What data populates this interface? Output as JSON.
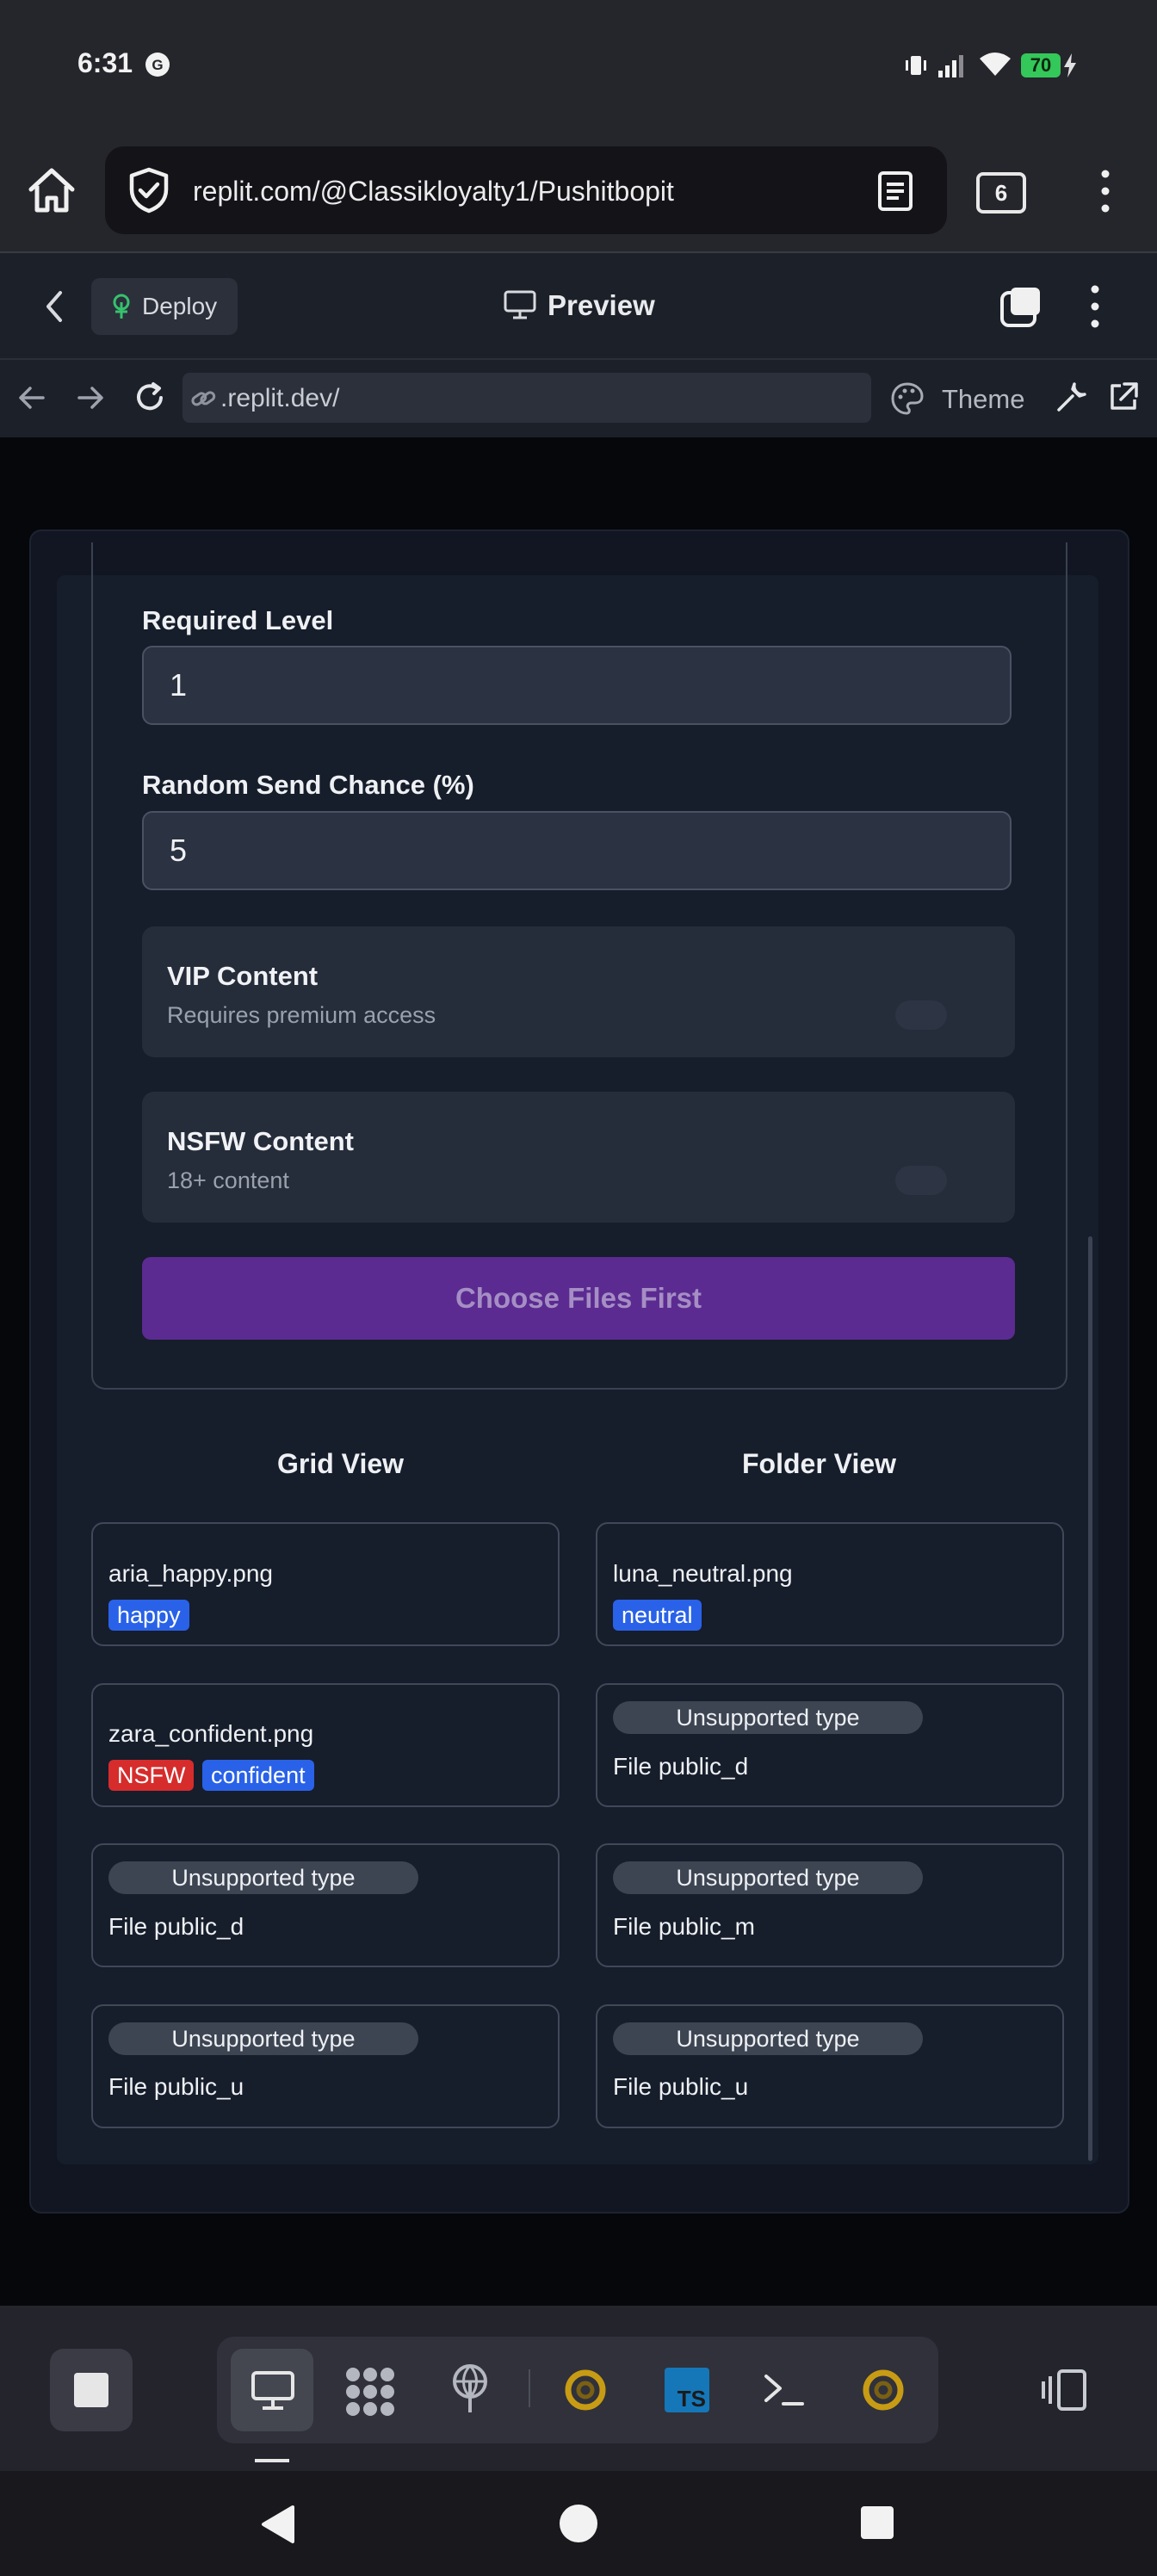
{
  "status_bar": {
    "time": "6:31",
    "battery": "70"
  },
  "browser": {
    "url": "replit.com/@Classikloyalty1/Pushitbopit",
    "tab_count": "6"
  },
  "replit": {
    "deploy_label": "Deploy",
    "preview_label": "Preview",
    "url": ".replit.dev/",
    "theme_label": "Theme"
  },
  "form": {
    "required_level_label": "Required Level",
    "required_level_value": "1",
    "random_send_label": "Random Send Chance (%)",
    "random_send_value": "5",
    "vip_title": "VIP Content",
    "vip_desc": "Requires premium access",
    "nsfw_title": "NSFW Content",
    "nsfw_desc": "18+ content",
    "submit_label": "Choose Files First"
  },
  "views": {
    "grid_label": "Grid View",
    "folder_label": "Folder View"
  },
  "files": [
    {
      "name": "aria_happy.png",
      "tags": [
        "happy"
      ]
    },
    {
      "name": "luna_neutral.png",
      "tags": [
        "neutral"
      ]
    },
    {
      "name": "zara_confident.png",
      "tags": [
        "NSFW",
        "confident"
      ]
    },
    {
      "unsupported": "Unsupported type",
      "name": "File public_d"
    },
    {
      "unsupported": "Unsupported type",
      "name": "File public_d"
    },
    {
      "unsupported": "Unsupported type",
      "name": "File public_m"
    },
    {
      "unsupported": "Unsupported type",
      "name": "File public_u"
    },
    {
      "unsupported": "Unsupported type",
      "name": "File public_u"
    }
  ],
  "colors": {
    "accent_purple": "#5b2b91",
    "tag_blue": "#2962e8",
    "tag_red": "#d62c2c",
    "battery_green": "#34c759"
  },
  "icons": [
    "home-icon",
    "shield-check-icon",
    "reader-mode-icon",
    "tabs-icon",
    "more-vert-icon",
    "back-chevron-icon",
    "deploy-icon",
    "monitor-icon",
    "new-tab-icon",
    "arrow-left-icon",
    "arrow-right-icon",
    "reload-icon",
    "link-icon",
    "palette-icon",
    "wrench-icon",
    "external-link-icon"
  ]
}
